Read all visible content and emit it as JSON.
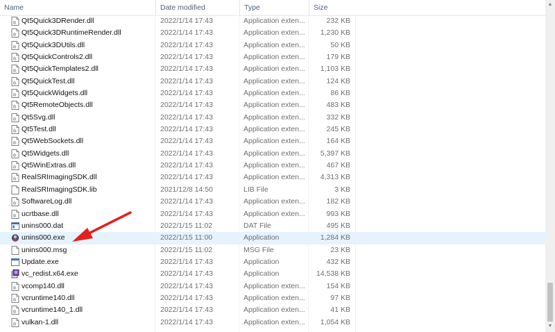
{
  "columns": {
    "name": "Name",
    "date": "Date modified",
    "type": "Type",
    "size": "Size"
  },
  "colors": {
    "arrow": "#e3211c",
    "selected_row": "#e5f3ff"
  },
  "files": [
    {
      "name": "Qt5Quick3DRender.dll",
      "date": "2022/1/14 17:43",
      "type": "Application exten...",
      "size": "232 KB",
      "icon": "dll-icon"
    },
    {
      "name": "Qt5Quick3DRuntimeRender.dll",
      "date": "2022/1/14 17:43",
      "type": "Application exten...",
      "size": "1,230 KB",
      "icon": "dll-icon"
    },
    {
      "name": "Qt5Quick3DUtils.dll",
      "date": "2022/1/14 17:43",
      "type": "Application exten...",
      "size": "50 KB",
      "icon": "dll-icon"
    },
    {
      "name": "Qt5QuickControls2.dll",
      "date": "2022/1/14 17:43",
      "type": "Application exten...",
      "size": "179 KB",
      "icon": "dll-icon"
    },
    {
      "name": "Qt5QuickTemplates2.dll",
      "date": "2022/1/14 17:43",
      "type": "Application exten...",
      "size": "1,103 KB",
      "icon": "dll-icon"
    },
    {
      "name": "Qt5QuickTest.dll",
      "date": "2022/1/14 17:43",
      "type": "Application exten...",
      "size": "124 KB",
      "icon": "dll-icon"
    },
    {
      "name": "Qt5QuickWidgets.dll",
      "date": "2022/1/14 17:43",
      "type": "Application exten...",
      "size": "86 KB",
      "icon": "dll-icon"
    },
    {
      "name": "Qt5RemoteObjects.dll",
      "date": "2022/1/14 17:43",
      "type": "Application exten...",
      "size": "483 KB",
      "icon": "dll-icon"
    },
    {
      "name": "Qt5Svg.dll",
      "date": "2022/1/14 17:43",
      "type": "Application exten...",
      "size": "332 KB",
      "icon": "dll-icon"
    },
    {
      "name": "Qt5Test.dll",
      "date": "2022/1/14 17:43",
      "type": "Application exten...",
      "size": "245 KB",
      "icon": "dll-icon"
    },
    {
      "name": "Qt5WebSockets.dll",
      "date": "2022/1/14 17:43",
      "type": "Application exten...",
      "size": "164 KB",
      "icon": "dll-icon"
    },
    {
      "name": "Qt5Widgets.dll",
      "date": "2022/1/14 17:43",
      "type": "Application exten...",
      "size": "5,397 KB",
      "icon": "dll-icon"
    },
    {
      "name": "Qt5WinExtras.dll",
      "date": "2022/1/14 17:43",
      "type": "Application exten...",
      "size": "467 KB",
      "icon": "dll-icon"
    },
    {
      "name": "RealSRImagingSDK.dll",
      "date": "2022/1/14 17:43",
      "type": "Application exten...",
      "size": "4,313 KB",
      "icon": "dll-icon"
    },
    {
      "name": "RealSRImagingSDK.lib",
      "date": "2021/12/8 14:50",
      "type": "LIB File",
      "size": "3 KB",
      "icon": "file-icon"
    },
    {
      "name": "SoftwareLog.dll",
      "date": "2022/1/14 17:43",
      "type": "Application exten...",
      "size": "182 KB",
      "icon": "dll-icon"
    },
    {
      "name": "ucrtbase.dll",
      "date": "2022/1/14 17:43",
      "type": "Application exten...",
      "size": "993 KB",
      "icon": "dll-icon"
    },
    {
      "name": "unins000.dat",
      "date": "2022/1/15 11:02",
      "type": "DAT File",
      "size": "495 KB",
      "icon": "dat-icon"
    },
    {
      "name": "unins000.exe",
      "date": "2022/1/15 11:00",
      "type": "Application",
      "size": "1,284 KB",
      "icon": "uninstaller-icon",
      "selected": true
    },
    {
      "name": "unins000.msg",
      "date": "2022/1/15 11:02",
      "type": "MSG File",
      "size": "23 KB",
      "icon": "file-icon"
    },
    {
      "name": "Update.exe",
      "date": "2022/1/14 17:43",
      "type": "Application",
      "size": "432 KB",
      "icon": "app-icon"
    },
    {
      "name": "vc_redist.x64.exe",
      "date": "2022/1/14 17:43",
      "type": "Application",
      "size": "14,538 KB",
      "icon": "installer-icon"
    },
    {
      "name": "vcomp140.dll",
      "date": "2022/1/14 17:43",
      "type": "Application exten...",
      "size": "154 KB",
      "icon": "dll-icon"
    },
    {
      "name": "vcruntime140.dll",
      "date": "2022/1/14 17:43",
      "type": "Application exten...",
      "size": "97 KB",
      "icon": "dll-icon"
    },
    {
      "name": "vcruntime140_1.dll",
      "date": "2022/1/14 17:43",
      "type": "Application exten...",
      "size": "41 KB",
      "icon": "dll-icon"
    },
    {
      "name": "vulkan-1.dll",
      "date": "2022/1/14 17:43",
      "type": "Application exten...",
      "size": "1,054 KB",
      "icon": "dll-icon"
    }
  ]
}
